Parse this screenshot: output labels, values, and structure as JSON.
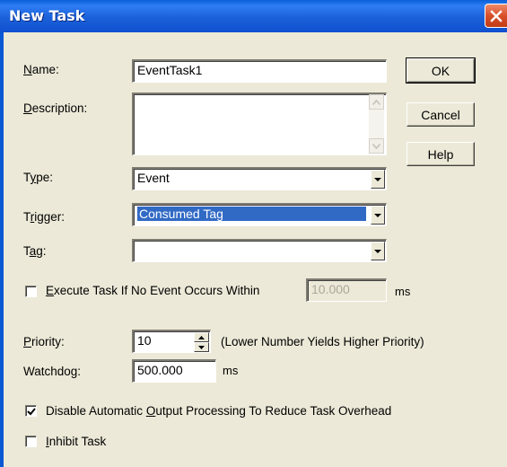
{
  "window": {
    "title": "New Task",
    "close_icon": "close-icon"
  },
  "form": {
    "name": {
      "label_pre": "",
      "label_key": "N",
      "label_post": "ame:",
      "value": "EventTask1"
    },
    "description": {
      "label_pre": "",
      "label_key": "D",
      "label_post": "escription:",
      "value": ""
    },
    "type": {
      "label_pre": "T",
      "label_key": "y",
      "label_post": "pe:",
      "value": "Event"
    },
    "trigger": {
      "label_pre": "T",
      "label_key": "r",
      "label_post": "igger:",
      "value": "Consumed Tag"
    },
    "tag": {
      "label_pre": "T",
      "label_key": "a",
      "label_post": "g:",
      "value": ""
    },
    "execute": {
      "checked": false,
      "label_pre": "",
      "label_key": "E",
      "label_post": "xecute Task If No Event Occurs Within",
      "value": "10.000",
      "unit": "ms"
    },
    "priority": {
      "label_pre": "",
      "label_key": "P",
      "label_post": "riority:",
      "value": "10",
      "hint": "(Lower Number Yields Higher Priority)"
    },
    "watchdog": {
      "label_pre": "Watchdo",
      "label_key": "g",
      "label_post": ":",
      "value": "500.000",
      "unit": "ms"
    },
    "disable_output": {
      "checked": true,
      "label_pre": "Disable Automatic ",
      "label_key": "O",
      "label_post": "utput Processing To Reduce Task Overhead"
    },
    "inhibit": {
      "checked": false,
      "label_pre": "",
      "label_key": "I",
      "label_post": "nhibit Task"
    }
  },
  "buttons": {
    "ok": "OK",
    "cancel": "Cancel",
    "help": "Help"
  },
  "colors": {
    "titlebar": "#0a5fd8",
    "dialog_bg": "#ece9d8",
    "selection": "#316ac5",
    "close": "#d8502a"
  }
}
